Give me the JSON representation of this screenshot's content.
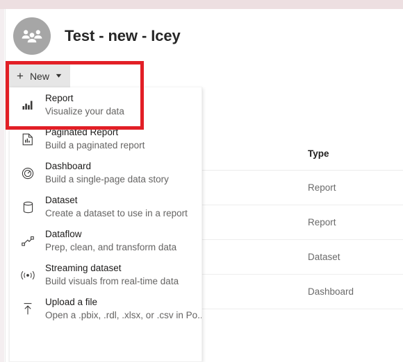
{
  "workspace": {
    "title": "Test - new - Icey",
    "avatar_icon": "group-people-icon",
    "avatar_color": "#a6a6a6"
  },
  "toolbar": {
    "new_button": {
      "label": "New",
      "plus_icon": "plus-icon",
      "chevron_icon": "chevron-down-icon"
    }
  },
  "menu": {
    "items": [
      {
        "icon": "bar-chart-icon",
        "title": "Report",
        "subtitle": "Visualize your data"
      },
      {
        "icon": "paginated-report-icon",
        "title": "Paginated Report",
        "subtitle": "Build a paginated report"
      },
      {
        "icon": "gauge-icon",
        "title": "Dashboard",
        "subtitle": "Build a single-page data story"
      },
      {
        "icon": "database-icon",
        "title": "Dataset",
        "subtitle": "Create a dataset to use in a report"
      },
      {
        "icon": "dataflow-icon",
        "title": "Dataflow",
        "subtitle": "Prep, clean, and transform data"
      },
      {
        "icon": "streaming-icon",
        "title": "Streaming dataset",
        "subtitle": "Build visuals from real-time data"
      },
      {
        "icon": "upload-icon",
        "title": "Upload a file",
        "subtitle": "Open a .pbix, .rdl, .xlsx, or .csv in Po..."
      }
    ]
  },
  "annotation": {
    "highlight_color": "#e21f26"
  },
  "content": {
    "table": {
      "columns": [
        "Type"
      ],
      "rows": [
        [
          "Report"
        ],
        [
          "Report"
        ],
        [
          "Dataset"
        ],
        [
          "Dashboard"
        ]
      ]
    }
  }
}
